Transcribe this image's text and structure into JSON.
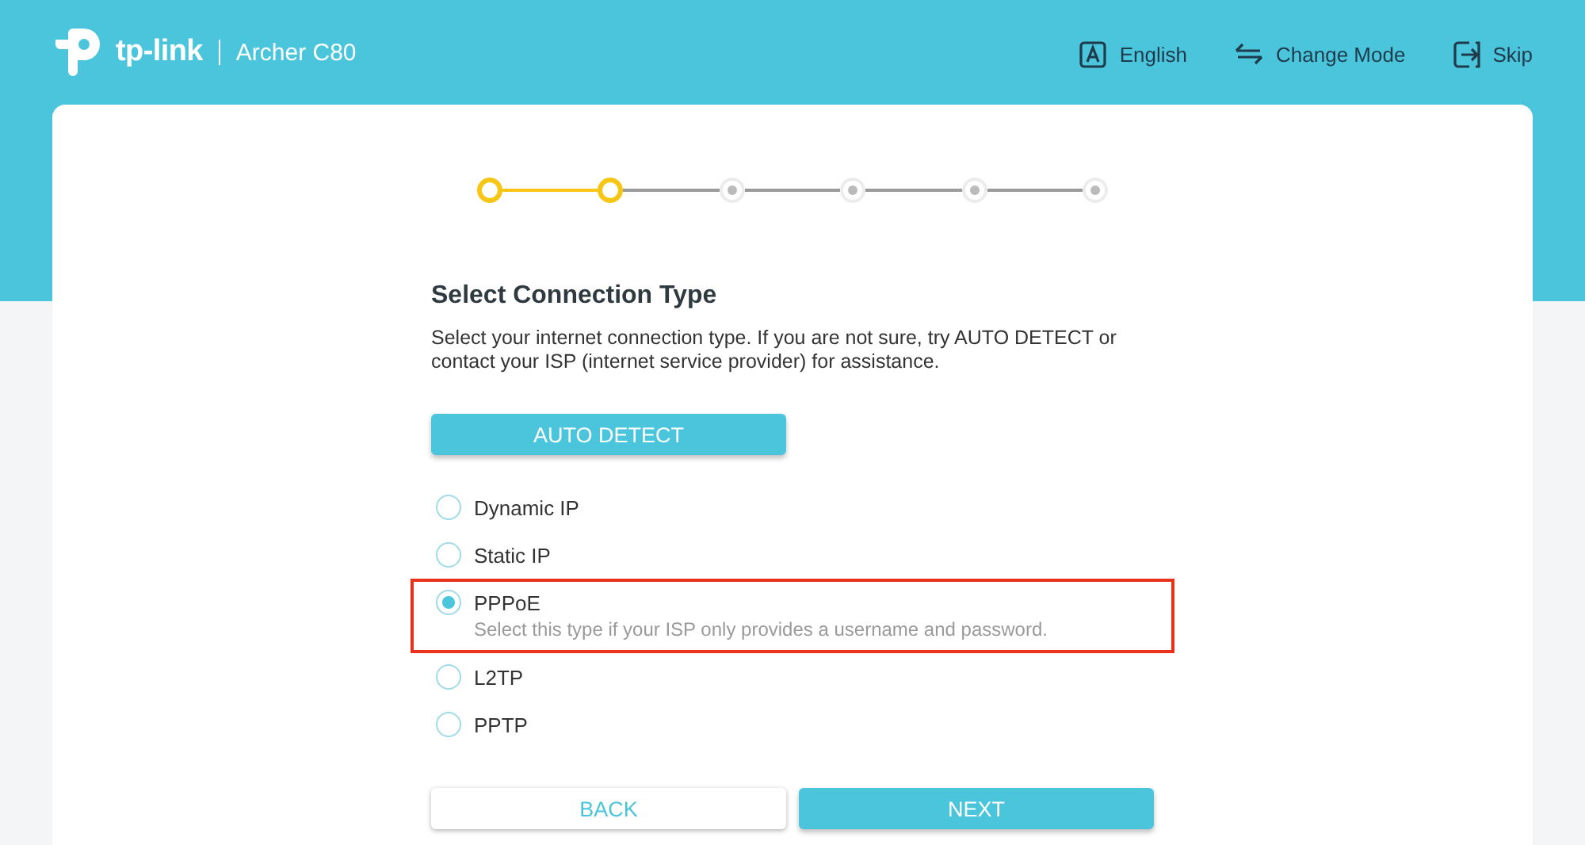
{
  "header": {
    "brand": "tp-link",
    "model": "Archer C80",
    "actions": [
      {
        "kind": "language",
        "label": "English"
      },
      {
        "kind": "mode",
        "label": "Change Mode"
      },
      {
        "kind": "skip",
        "label": "Skip"
      }
    ]
  },
  "steps": [
    {
      "done": true
    },
    {
      "done": true
    },
    {
      "done": false
    },
    {
      "done": false
    },
    {
      "done": false
    },
    {
      "done": false
    }
  ],
  "title": "Select Connection Type",
  "description": "Select your internet connection type. If you are not sure, try AUTO DETECT or contact your ISP (internet service provider) for assistance.",
  "auto_detect_button": "AUTO DETECT",
  "options": [
    {
      "label": "Dynamic IP",
      "selected": false,
      "highlighted": false
    },
    {
      "label": "Static IP",
      "selected": false,
      "highlighted": false
    },
    {
      "label": "PPPoE",
      "selected": true,
      "highlighted": true,
      "hint": "Select this type if your ISP only provides a username and password."
    },
    {
      "label": "L2TP",
      "selected": false,
      "highlighted": false
    },
    {
      "label": "PPTP",
      "selected": false,
      "highlighted": false
    }
  ],
  "buttons": [
    {
      "kind": "secondary",
      "label": "BACK"
    },
    {
      "kind": "primary",
      "label": "NEXT"
    }
  ]
}
